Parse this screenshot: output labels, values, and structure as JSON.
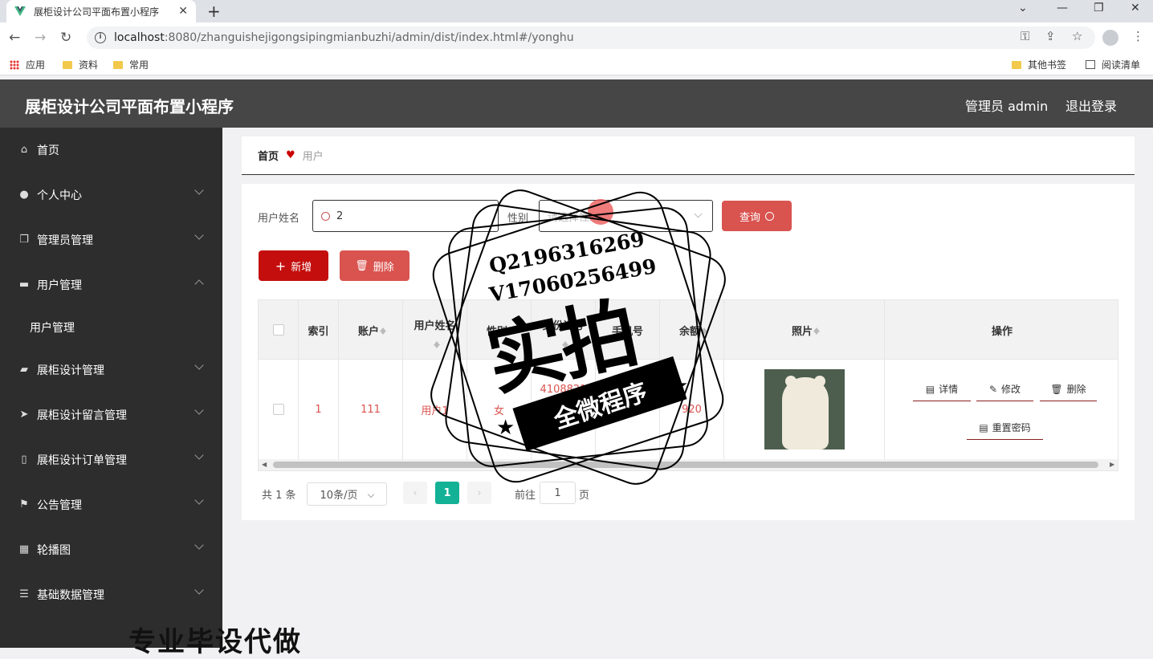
{
  "browser": {
    "tab_title": "展柜设计公司平面布置小程序",
    "url_host": "localhost",
    "url_rest": ":8080/zhanguishejigongsipingmianbuzhi/admin/dist/index.html#/yonghu",
    "bookmarks": [
      "应用",
      "资料",
      "常用"
    ],
    "bookmarks_right": [
      "其他书签",
      "阅读清单"
    ]
  },
  "header": {
    "title": "展柜设计公司平面布置小程序",
    "user": "管理员 admin",
    "logout": "退出登录"
  },
  "sidebar": {
    "items": [
      {
        "label": "首页",
        "icon": "home-icon"
      },
      {
        "label": "个人中心",
        "icon": "user-icon"
      },
      {
        "label": "管理员管理",
        "icon": "copy-icon"
      },
      {
        "label": "用户管理",
        "icon": "monitor-icon"
      },
      {
        "label": "展柜设计管理",
        "icon": "briefcase-icon"
      },
      {
        "label": "展柜设计留言管理",
        "icon": "send-icon"
      },
      {
        "label": "展柜设计订单管理",
        "icon": "phone-icon"
      },
      {
        "label": "公告管理",
        "icon": "flag-icon"
      },
      {
        "label": "轮播图",
        "icon": "grid-icon"
      },
      {
        "label": "基础数据管理",
        "icon": "menu-icon"
      }
    ],
    "sub_item": "用户管理"
  },
  "breadcrumb": {
    "home": "首页",
    "current": "用户"
  },
  "search": {
    "name_label": "用户姓名",
    "name_value": "2",
    "gender_label": "性别",
    "gender_placeholder": "请选择性别",
    "query_button": "查询"
  },
  "actions": {
    "add": "新增",
    "delete": "删除"
  },
  "table": {
    "headers": [
      "索引",
      "账户",
      "用户姓名",
      "性别",
      "身份证号",
      "手机号",
      "余额",
      "照片",
      "操作"
    ],
    "rows": [
      {
        "index": "1",
        "account": "111",
        "name": "用户1",
        "gender": "女",
        "idcard": "4108821",
        "phone": "",
        "balance": "920"
      }
    ],
    "row_actions": [
      "详情",
      "修改",
      "删除",
      "重置密码"
    ]
  },
  "pagination": {
    "total": "共 1 条",
    "page_size": "10条/页",
    "current": "1",
    "goto_label": "前往",
    "goto_value": "1",
    "page_suffix": "页"
  },
  "watermark": {
    "line1": "Q2196316269",
    "line2": "V17060256499",
    "big": "实拍",
    "ribbon": "全微程序",
    "bottom": "专业毕设代做"
  },
  "colors": {
    "primary_red": "#c40e0e",
    "soft_red": "#d9534f",
    "header_bg": "#464646",
    "sidebar_bg": "#2d2d2d"
  }
}
